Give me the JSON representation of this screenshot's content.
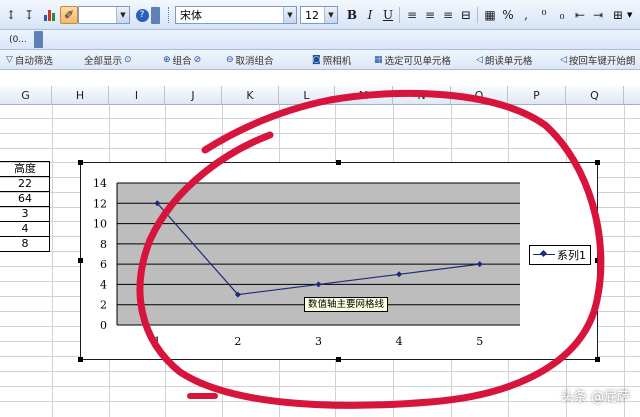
{
  "toolbar_format": {
    "font_name": "宋体",
    "font_size": "12",
    "bold": "B",
    "italic": "I",
    "underline": "U",
    "percent": "%"
  },
  "toolbar_filter": {
    "items": [
      "自动筛选",
      "全部显示",
      "组合",
      "取消组合",
      "照相机",
      "选定可见单元格",
      "朗读单元格",
      "按回车键开始朗"
    ]
  },
  "columns": [
    "G",
    "H",
    "I",
    "J",
    "K",
    "L",
    "M",
    "N",
    "O",
    "P",
    "Q"
  ],
  "column_g_cells": [
    "高度",
    "22",
    "64",
    "3",
    "4",
    "8"
  ],
  "chart_data": {
    "type": "line",
    "categories": [
      "1",
      "2",
      "3",
      "4",
      "5"
    ],
    "series": [
      {
        "name": "系列1",
        "values": [
          12,
          3,
          4,
          5,
          6
        ]
      }
    ],
    "ylim": [
      0,
      14
    ],
    "yticks": [
      "0",
      "2",
      "4",
      "6",
      "8",
      "10",
      "12",
      "14"
    ],
    "grid": true,
    "legend": "right",
    "tooltip": "数值轴主要网格线",
    "colors": {
      "series": "#1f2a7a",
      "plot_area": "#bdbdbd",
      "annotation": "#d7143c"
    }
  },
  "watermark": "头条 @屁萨"
}
